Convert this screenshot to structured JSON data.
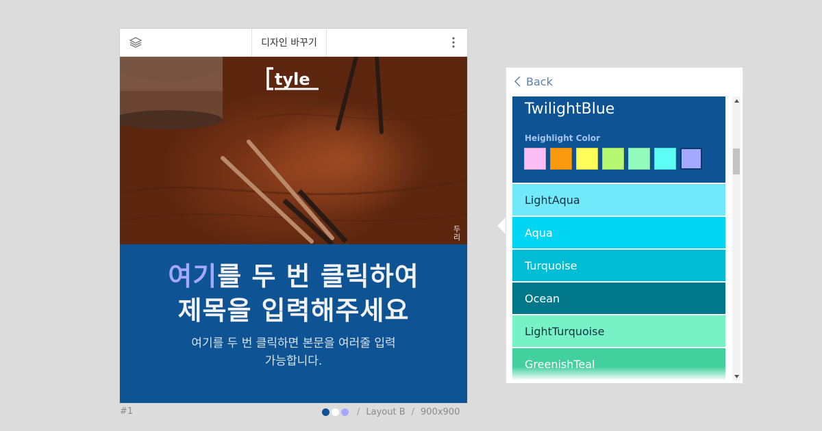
{
  "toolbar": {
    "design_label": "디자인 바꾸기"
  },
  "canvas": {
    "logo_text": "tyle",
    "photo_caption": "두리",
    "headline_highlight": "여기",
    "headline_rest_line1": "를 두 번 클릭하여",
    "headline_line2": "제목을 입력해주세요",
    "body_line1": "여기를 두 번 클릭하면 본문을 여러줄 입력",
    "body_line2": "가능합니다."
  },
  "footer": {
    "index": "#1",
    "layout": "Layout B",
    "size": "900x900",
    "dot_colors": [
      "#0e5393",
      "#ffffff",
      "#a4a8ff"
    ]
  },
  "panel": {
    "back_label": "Back",
    "selected": {
      "name": "TwilightBlue",
      "color": "#0e5393",
      "highlight_label": "Heighlight Color",
      "swatches": [
        "#fbbff5",
        "#fb9a0e",
        "#fdfc59",
        "#b7f772",
        "#92fabd",
        "#5bfdf4",
        "#a4a8ff"
      ]
    },
    "options": [
      {
        "name": "LightAqua",
        "color": "#72e9fb",
        "text": "#123040"
      },
      {
        "name": "Aqua",
        "color": "#00d5f3",
        "text": "#ffffff"
      },
      {
        "name": "Turquoise",
        "color": "#00bdd6",
        "text": "#ffffff"
      },
      {
        "name": "Ocean",
        "color": "#00788a",
        "text": "#ffffff"
      },
      {
        "name": "LightTurquoise",
        "color": "#77f2c6",
        "text": "#123040"
      },
      {
        "name": "GreenishTeal",
        "color": "#42d09f",
        "text": "#ffffff"
      }
    ]
  }
}
